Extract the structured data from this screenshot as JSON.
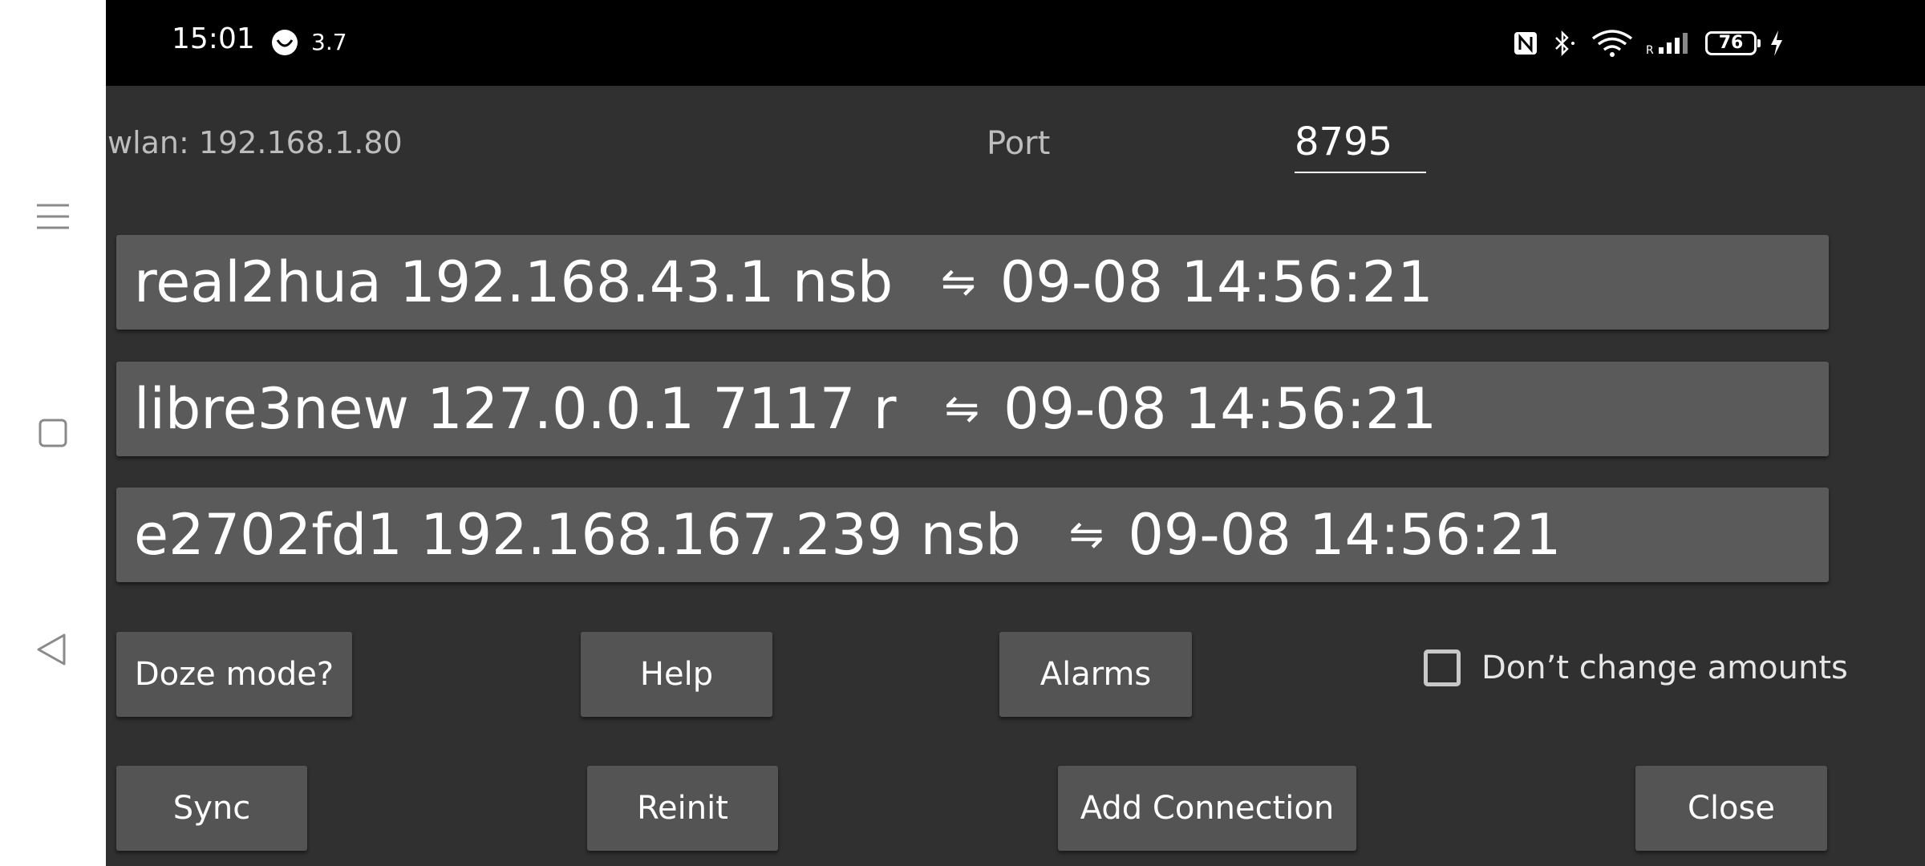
{
  "status_bar": {
    "time": "15:01",
    "notification_text": "3.7",
    "battery_level": "76",
    "icons": [
      "nfc-icon",
      "bluetooth-icon",
      "wifi-icon",
      "signal-icon",
      "battery-icon",
      "charging-icon"
    ]
  },
  "network": {
    "wlan_text": "wlan: 192.168.1.80",
    "port_label": "Port",
    "port_value": "8795"
  },
  "connections": [
    {
      "info": "real2hua 192.168.43.1 nsb",
      "arrows": "⇋",
      "timestamp": "09-08 14:56:21"
    },
    {
      "info": "libre3new 127.0.0.1 7117 r",
      "arrows": "⇋",
      "timestamp": "09-08 14:56:21"
    },
    {
      "info": "e2702fd1 192.168.167.239 nsb",
      "arrows": "⇋",
      "timestamp": "09-08 14:56:21"
    }
  ],
  "buttons": {
    "doze": "Doze mode?",
    "help": "Help",
    "alarms": "Alarms",
    "sync": "Sync",
    "reinit": "Reinit",
    "add_connection": "Add Connection",
    "close": "Close"
  },
  "checkbox": {
    "label": "Don’t change amounts",
    "checked": false
  },
  "colors": {
    "background": "#303030",
    "row_background": "#5a5a5a",
    "button_background": "#545454",
    "status_bar": "#000000",
    "nav_bar": "#ffffff"
  }
}
